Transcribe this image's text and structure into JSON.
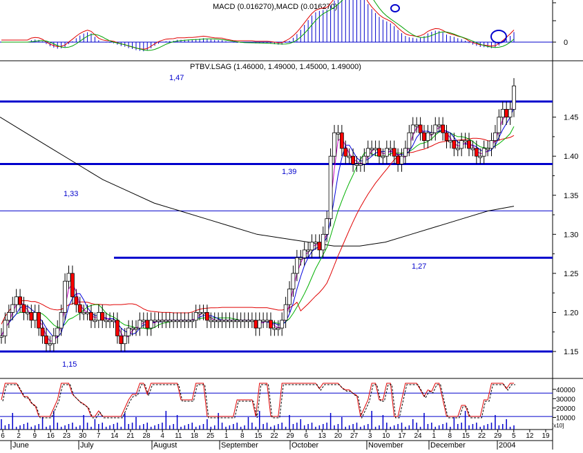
{
  "chart_data": [
    {
      "panel": "macd",
      "type": "line",
      "title": "MACD (0.016270),MACD (0.016270)",
      "y_ticks": [
        "0"
      ],
      "highlight_circles": 2
    },
    {
      "panel": "price",
      "type": "candlestick",
      "title": "PTBV.LSAG (1.46000, 1.49000, 1.45000, 1.49000)",
      "ylim": [
        1.13,
        1.52
      ],
      "y_ticks": [
        1.15,
        1.2,
        1.25,
        1.3,
        1.35,
        1.4,
        1.45
      ],
      "horizontal_levels": [
        {
          "value": 1.47,
          "label": "1,47"
        },
        {
          "value": 1.39,
          "label": "1,39"
        },
        {
          "value": 1.33,
          "label": "1,33"
        },
        {
          "value": 1.27,
          "label": "1,27"
        },
        {
          "value": 1.15,
          "label": "1,15"
        }
      ],
      "sessions": 160,
      "closes": [
        1.17,
        1.19,
        1.2,
        1.21,
        1.22,
        1.21,
        1.2,
        1.2,
        1.19,
        1.2,
        1.18,
        1.17,
        1.16,
        1.16,
        1.17,
        1.18,
        1.2,
        1.24,
        1.25,
        1.22,
        1.21,
        1.2,
        1.2,
        1.2,
        1.19,
        1.19,
        1.2,
        1.19,
        1.19,
        1.19,
        1.19,
        1.17,
        1.16,
        1.17,
        1.18,
        1.18,
        1.18,
        1.19,
        1.19,
        1.18,
        1.19,
        1.19,
        1.19,
        1.19,
        1.19,
        1.19,
        1.19,
        1.19,
        1.19,
        1.19,
        1.19,
        1.19,
        1.2,
        1.2,
        1.2,
        1.19,
        1.19,
        1.19,
        1.19,
        1.19,
        1.19,
        1.19,
        1.19,
        1.19,
        1.19,
        1.19,
        1.19,
        1.19,
        1.18,
        1.19,
        1.19,
        1.19,
        1.18,
        1.18,
        1.18,
        1.19,
        1.21,
        1.23,
        1.25,
        1.27,
        1.27,
        1.28,
        1.28,
        1.29,
        1.29,
        1.28,
        1.3,
        1.32,
        1.4,
        1.43,
        1.43,
        1.41,
        1.4,
        1.4,
        1.39,
        1.39,
        1.39,
        1.4,
        1.41,
        1.41,
        1.41,
        1.4,
        1.4,
        1.41,
        1.41,
        1.4,
        1.39,
        1.4,
        1.41,
        1.43,
        1.44,
        1.44,
        1.43,
        1.42,
        1.43,
        1.43,
        1.44,
        1.44,
        1.43,
        1.42,
        1.42,
        1.41,
        1.41,
        1.42,
        1.42,
        1.41,
        1.41,
        1.4,
        1.4,
        1.41,
        1.41,
        1.42,
        1.43,
        1.45,
        1.46,
        1.45,
        1.46,
        1.49
      ],
      "x_ticks": [
        "6",
        "2",
        "9",
        "16",
        "23",
        "30",
        "7",
        "14",
        "21",
        "28",
        "4",
        "11",
        "18",
        "25",
        "1",
        "8",
        "15",
        "22",
        "29",
        "6",
        "13",
        "20",
        "27",
        "3",
        "10",
        "17",
        "24",
        "1",
        "8",
        "15",
        "22",
        "29",
        "5",
        "12",
        "19"
      ],
      "months": [
        "June",
        "July",
        "August",
        "September",
        "October",
        "November",
        "December",
        "2004"
      ]
    },
    {
      "panel": "volume",
      "type": "bar",
      "y_ticks": [
        "40000",
        "30000",
        "20000",
        "10000"
      ],
      "y_unit": "[x10]",
      "ylim": [
        0,
        45000
      ],
      "reference_lines": [
        36000,
        11000
      ]
    }
  ],
  "colors": {
    "level_line": "#0000cc",
    "stoch": "#cc0000",
    "price_axis_text": "#000000"
  }
}
